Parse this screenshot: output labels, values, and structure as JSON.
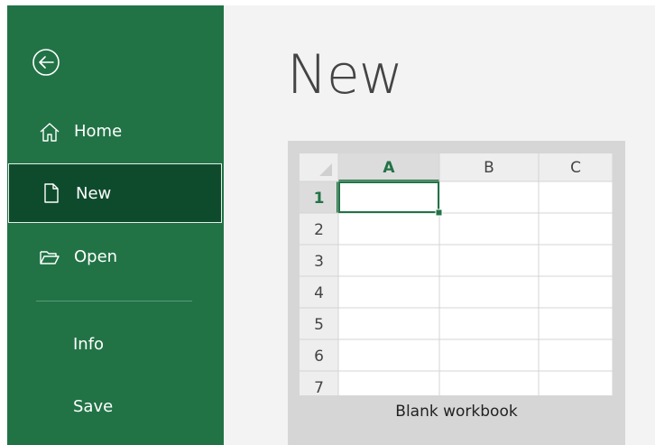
{
  "sidebar": {
    "back_icon": "back-arrow-icon",
    "items": [
      {
        "label": "Home",
        "icon": "home-icon"
      },
      {
        "label": "New",
        "icon": "new-file-icon",
        "selected": true
      },
      {
        "label": "Open",
        "icon": "open-folder-icon"
      },
      {
        "label": "Info"
      },
      {
        "label": "Save"
      }
    ]
  },
  "main": {
    "title": "New",
    "templates": [
      {
        "caption": "Blank workbook",
        "columns": [
          "A",
          "B",
          "C"
        ],
        "rows": [
          "1",
          "2",
          "3",
          "4",
          "5",
          "6",
          "7"
        ],
        "active_cell": "A1"
      }
    ]
  },
  "colors": {
    "sidebar_bg": "#217346",
    "selected_bg": "#0e4b2c",
    "accent_green": "#217346",
    "main_bg": "#f3f3f3",
    "card_bg": "#d6d6d6"
  }
}
